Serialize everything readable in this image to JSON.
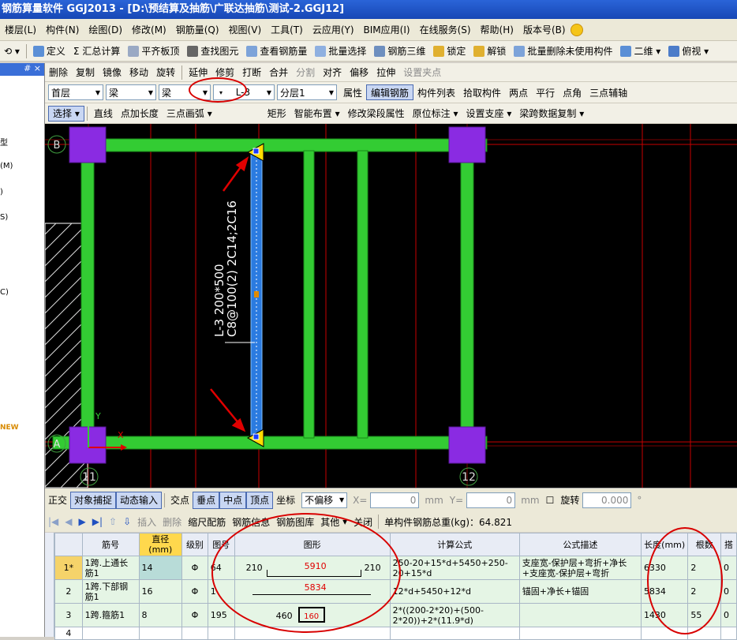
{
  "window": {
    "title": "钢筋算量软件 GGJ2013 - [D:\\预结算及抽筋\\广联达抽筋\\测试-2.GGJ12]"
  },
  "menu": [
    "楼层(L)",
    "构件(N)",
    "绘图(D)",
    "修改(M)",
    "钢筋量(Q)",
    "视图(V)",
    "工具(T)",
    "云应用(Y)",
    "BIM应用(I)",
    "在线服务(S)",
    "帮助(H)",
    "版本号(B)"
  ],
  "toolbar1": [
    "定义",
    "Σ 汇总计算",
    "平齐板顶",
    "查找图元",
    "查看钢筋量",
    "批量选择",
    "钢筋三维",
    "锁定",
    "解锁",
    "批量删除未使用构件",
    "二维",
    "俯视"
  ],
  "toolbar2": [
    "删除",
    "复制",
    "镜像",
    "移动",
    "旋转",
    "延伸",
    "修剪",
    "打断",
    "合并",
    "分割",
    "对齐",
    "偏移",
    "拉伸",
    "设置夹点"
  ],
  "toolbar3": {
    "floor": "首层",
    "type1": "梁",
    "type2": "梁",
    "component": "L-3",
    "layer": "分层1",
    "buttons": [
      "属性",
      "编辑钢筋",
      "构件列表",
      "拾取构件",
      "两点",
      "平行",
      "点角",
      "三点辅轴"
    ]
  },
  "toolbar4": [
    "选择",
    "直线",
    "点加长度",
    "三点画弧",
    "矩形",
    "智能布置",
    "修改梁段属性",
    "原位标注",
    "设置支座",
    "梁跨数据复制"
  ],
  "sidebar": {
    "pin": "# ×",
    "items": [
      "型",
      "(M)",
      ")",
      "S)",
      "C)",
      "NEW"
    ]
  },
  "canvas": {
    "axis_top": "B",
    "axis_left": "A",
    "axis_bottom_left": "11",
    "axis_bottom_right": "12",
    "beam_label_line1": "L-3 200*500",
    "beam_label_line2": "C8@100(2) 2C14;2C16",
    "ucs_y": "Y",
    "ucs_x": "X",
    "colors": {
      "beam": "#33cc33",
      "selected_beam": "#2b7be0",
      "column": "#8a2be2",
      "grid": "#ff0000",
      "background": "#000000"
    }
  },
  "snapbar": {
    "items": [
      "正交",
      "对象捕捉",
      "动态输入",
      "交点",
      "垂点",
      "中点",
      "顶点",
      "坐标"
    ],
    "offset_mode": "不偏移",
    "x_label": "X=",
    "x_value": "0",
    "y_label": "Y=",
    "y_value": "0",
    "unit": "mm",
    "rotate_label": "旋转",
    "rotate_value": "0.000",
    "degree": "°"
  },
  "gridbar": {
    "items": [
      "插入",
      "删除",
      "缩尺配筋",
      "钢筋信息",
      "钢筋图库",
      "其他",
      "关闭"
    ],
    "total_label": "单构件钢筋总重(kg)：64.821"
  },
  "table": {
    "headers": [
      "筋号",
      "直径(mm)",
      "级别",
      "图号",
      "图形",
      "计算公式",
      "公式描述",
      "长度(mm)",
      "根数",
      "搭"
    ],
    "rows": [
      {
        "idx": "1*",
        "name": "1跨.上通长筋1",
        "dia": "14",
        "grade": "Φ",
        "fig": "64",
        "shape_left": "210",
        "shape_mid": "5910",
        "shape_right": "210",
        "formula": "250-20+15*d+5450+250-20+15*d",
        "desc": "支座宽-保护层+弯折+净长+支座宽-保护层+弯折",
        "length": "6330",
        "count": "2",
        "lap": "0"
      },
      {
        "idx": "2",
        "name": "1跨.下部钢筋1",
        "dia": "16",
        "grade": "Φ",
        "fig": "1",
        "shape_left": "",
        "shape_mid": "5834",
        "shape_right": "",
        "formula": "12*d+5450+12*d",
        "desc": "锚固+净长+锚固",
        "length": "5834",
        "count": "2",
        "lap": "0"
      },
      {
        "idx": "3",
        "name": "1跨.箍筋1",
        "dia": "8",
        "grade": "Φ",
        "fig": "195",
        "shape_left": "460",
        "shape_mid": "160",
        "shape_right": "",
        "formula": "2*((200-2*20)+(500-2*20))+2*(11.9*d)",
        "desc": "",
        "length": "1430",
        "count": "55",
        "lap": "0"
      },
      {
        "idx": "4",
        "name": "",
        "dia": "",
        "grade": "",
        "fig": "",
        "shape_left": "",
        "shape_mid": "",
        "shape_right": "",
        "formula": "",
        "desc": "",
        "length": "",
        "count": "",
        "lap": ""
      }
    ]
  }
}
